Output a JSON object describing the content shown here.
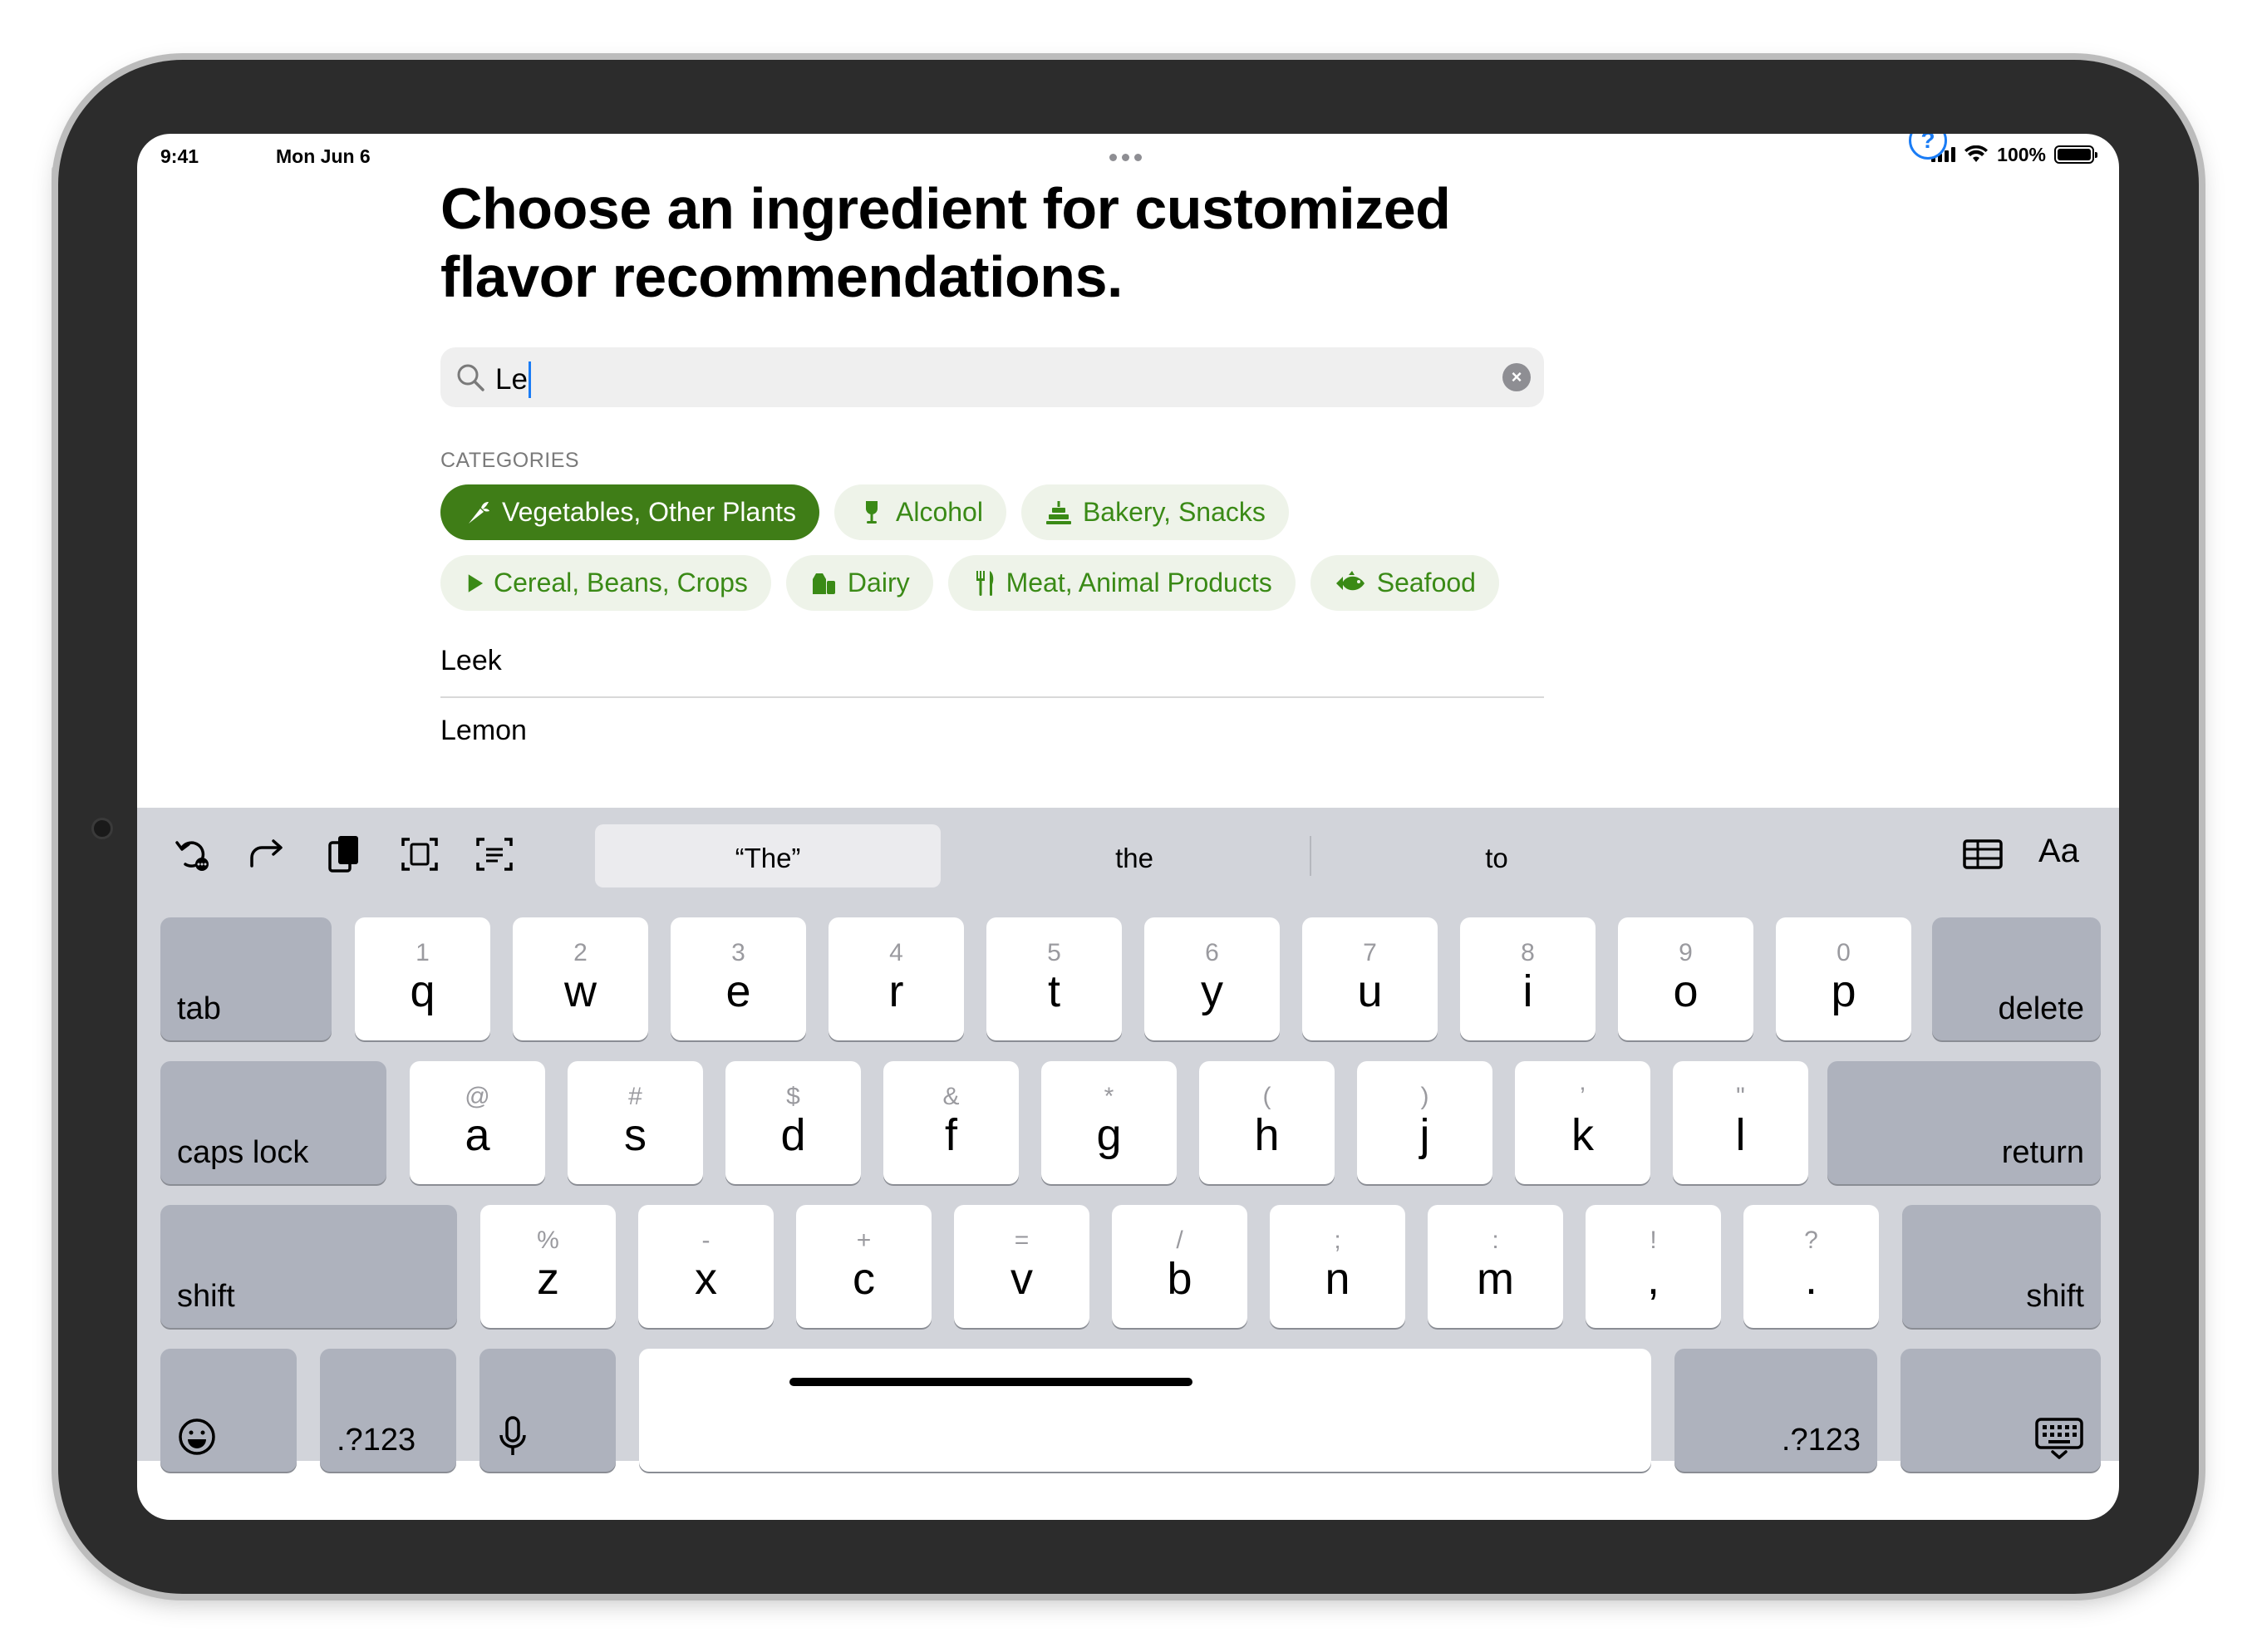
{
  "status_bar": {
    "time": "9:41",
    "date": "Mon Jun 6",
    "battery": "100%"
  },
  "header": {
    "help_label": "?",
    "title": "Choose an ingredient for customized flavor recommendations."
  },
  "search": {
    "value": "Le",
    "clear_label": "×"
  },
  "categories": {
    "label": "CATEGORIES",
    "items": [
      {
        "label": "Vegetables, Other Plants",
        "icon": "carrot-icon",
        "active": true
      },
      {
        "label": "Alcohol",
        "icon": "wine-glass-icon",
        "active": false
      },
      {
        "label": "Bakery, Snacks",
        "icon": "cake-icon",
        "active": false
      },
      {
        "label": "Cereal, Beans, Crops",
        "icon": "play-icon",
        "active": false
      },
      {
        "label": "Dairy",
        "icon": "milk-carton-icon",
        "active": false
      },
      {
        "label": "Meat, Animal Products",
        "icon": "fork-knife-icon",
        "active": false
      },
      {
        "label": "Seafood",
        "icon": "fish-icon",
        "active": false
      }
    ]
  },
  "results": [
    {
      "label": "Leek"
    },
    {
      "label": "Lemon"
    }
  ],
  "keyboard": {
    "suggestions": [
      "“The”",
      "the",
      "to"
    ],
    "format_label": "Aa",
    "rows": [
      [
        {
          "pri": "q",
          "sec": "1"
        },
        {
          "pri": "w",
          "sec": "2"
        },
        {
          "pri": "e",
          "sec": "3"
        },
        {
          "pri": "r",
          "sec": "4"
        },
        {
          "pri": "t",
          "sec": "5"
        },
        {
          "pri": "y",
          "sec": "6"
        },
        {
          "pri": "u",
          "sec": "7"
        },
        {
          "pri": "i",
          "sec": "8"
        },
        {
          "pri": "o",
          "sec": "9"
        },
        {
          "pri": "p",
          "sec": "0"
        }
      ],
      [
        {
          "pri": "a",
          "sec": "@"
        },
        {
          "pri": "s",
          "sec": "#"
        },
        {
          "pri": "d",
          "sec": "$"
        },
        {
          "pri": "f",
          "sec": "&"
        },
        {
          "pri": "g",
          "sec": "*"
        },
        {
          "pri": "h",
          "sec": "("
        },
        {
          "pri": "j",
          "sec": ")"
        },
        {
          "pri": "k",
          "sec": "’"
        },
        {
          "pri": "l",
          "sec": "\""
        }
      ],
      [
        {
          "pri": "z",
          "sec": "%"
        },
        {
          "pri": "x",
          "sec": "-"
        },
        {
          "pri": "c",
          "sec": "+"
        },
        {
          "pri": "v",
          "sec": "="
        },
        {
          "pri": "b",
          "sec": "/"
        },
        {
          "pri": "n",
          "sec": ";"
        },
        {
          "pri": "m",
          "sec": ":"
        },
        {
          "pri": ",",
          "sec": "!"
        },
        {
          "pri": ".",
          "sec": "?"
        }
      ]
    ],
    "tab": "tab",
    "delete": "delete",
    "caps_lock": "caps lock",
    "return": "return",
    "shift": "shift",
    "numbers": ".?123"
  },
  "colors": {
    "accent_green": "#3f7d17",
    "chip_bg": "#eef3e9",
    "chip_text": "#3a8a16",
    "link_blue": "#1a7cf5"
  }
}
